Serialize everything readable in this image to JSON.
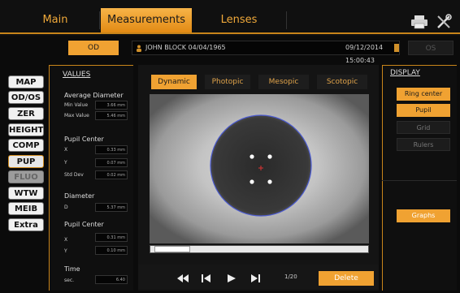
{
  "tabs": {
    "main": "Main",
    "measurements": "Measurements",
    "lenses": "Lenses"
  },
  "eye": {
    "od": "OD",
    "os": "OS"
  },
  "patient": {
    "name": "JOHN  BLOCK   04/04/1965",
    "datetime": "09/12/2014   15:00:43"
  },
  "sidebar": [
    "MAP",
    "OD/OS",
    "ZER",
    "HEIGHT",
    "COMP",
    "PUP",
    "FLUO",
    "WTW",
    "MEIB",
    "Extra"
  ],
  "values": {
    "title": "VALUES",
    "avg_diameter": {
      "label": "Average Diameter",
      "min_label": "Min Value",
      "min": "3.66 mm",
      "max_label": "Max Value",
      "max": "5.46 mm"
    },
    "pupil_center": {
      "label": "Pupil Center",
      "x_label": "X",
      "x": "0.33 mm",
      "y_label": "Y",
      "y": "0.07 mm",
      "std_label": "Std Dev",
      "std": "0.02 mm"
    },
    "diameter": {
      "label": "Diameter",
      "d_label": "D",
      "d": "5.37 mm"
    },
    "pupil_center2": {
      "label": "Pupil Center",
      "x_label": "X",
      "x": "0.31 mm",
      "y_label": "Y",
      "y": "0.10 mm"
    },
    "time": {
      "label": "Time",
      "sec_label": "sec.",
      "sec": "6.40"
    }
  },
  "filters": [
    "Dynamic",
    "Photopic",
    "Mesopic",
    "Scotopic"
  ],
  "playback": {
    "frame": "1/20",
    "delete": "Delete"
  },
  "display": {
    "title": "DISPLAY",
    "ring_center": "Ring center",
    "pupil": "Pupil",
    "grid": "Grid",
    "rulers": "Rulers",
    "graphs": "Graphs"
  },
  "colors": {
    "accent": "#f0a232",
    "background": "#0b0b0b"
  }
}
